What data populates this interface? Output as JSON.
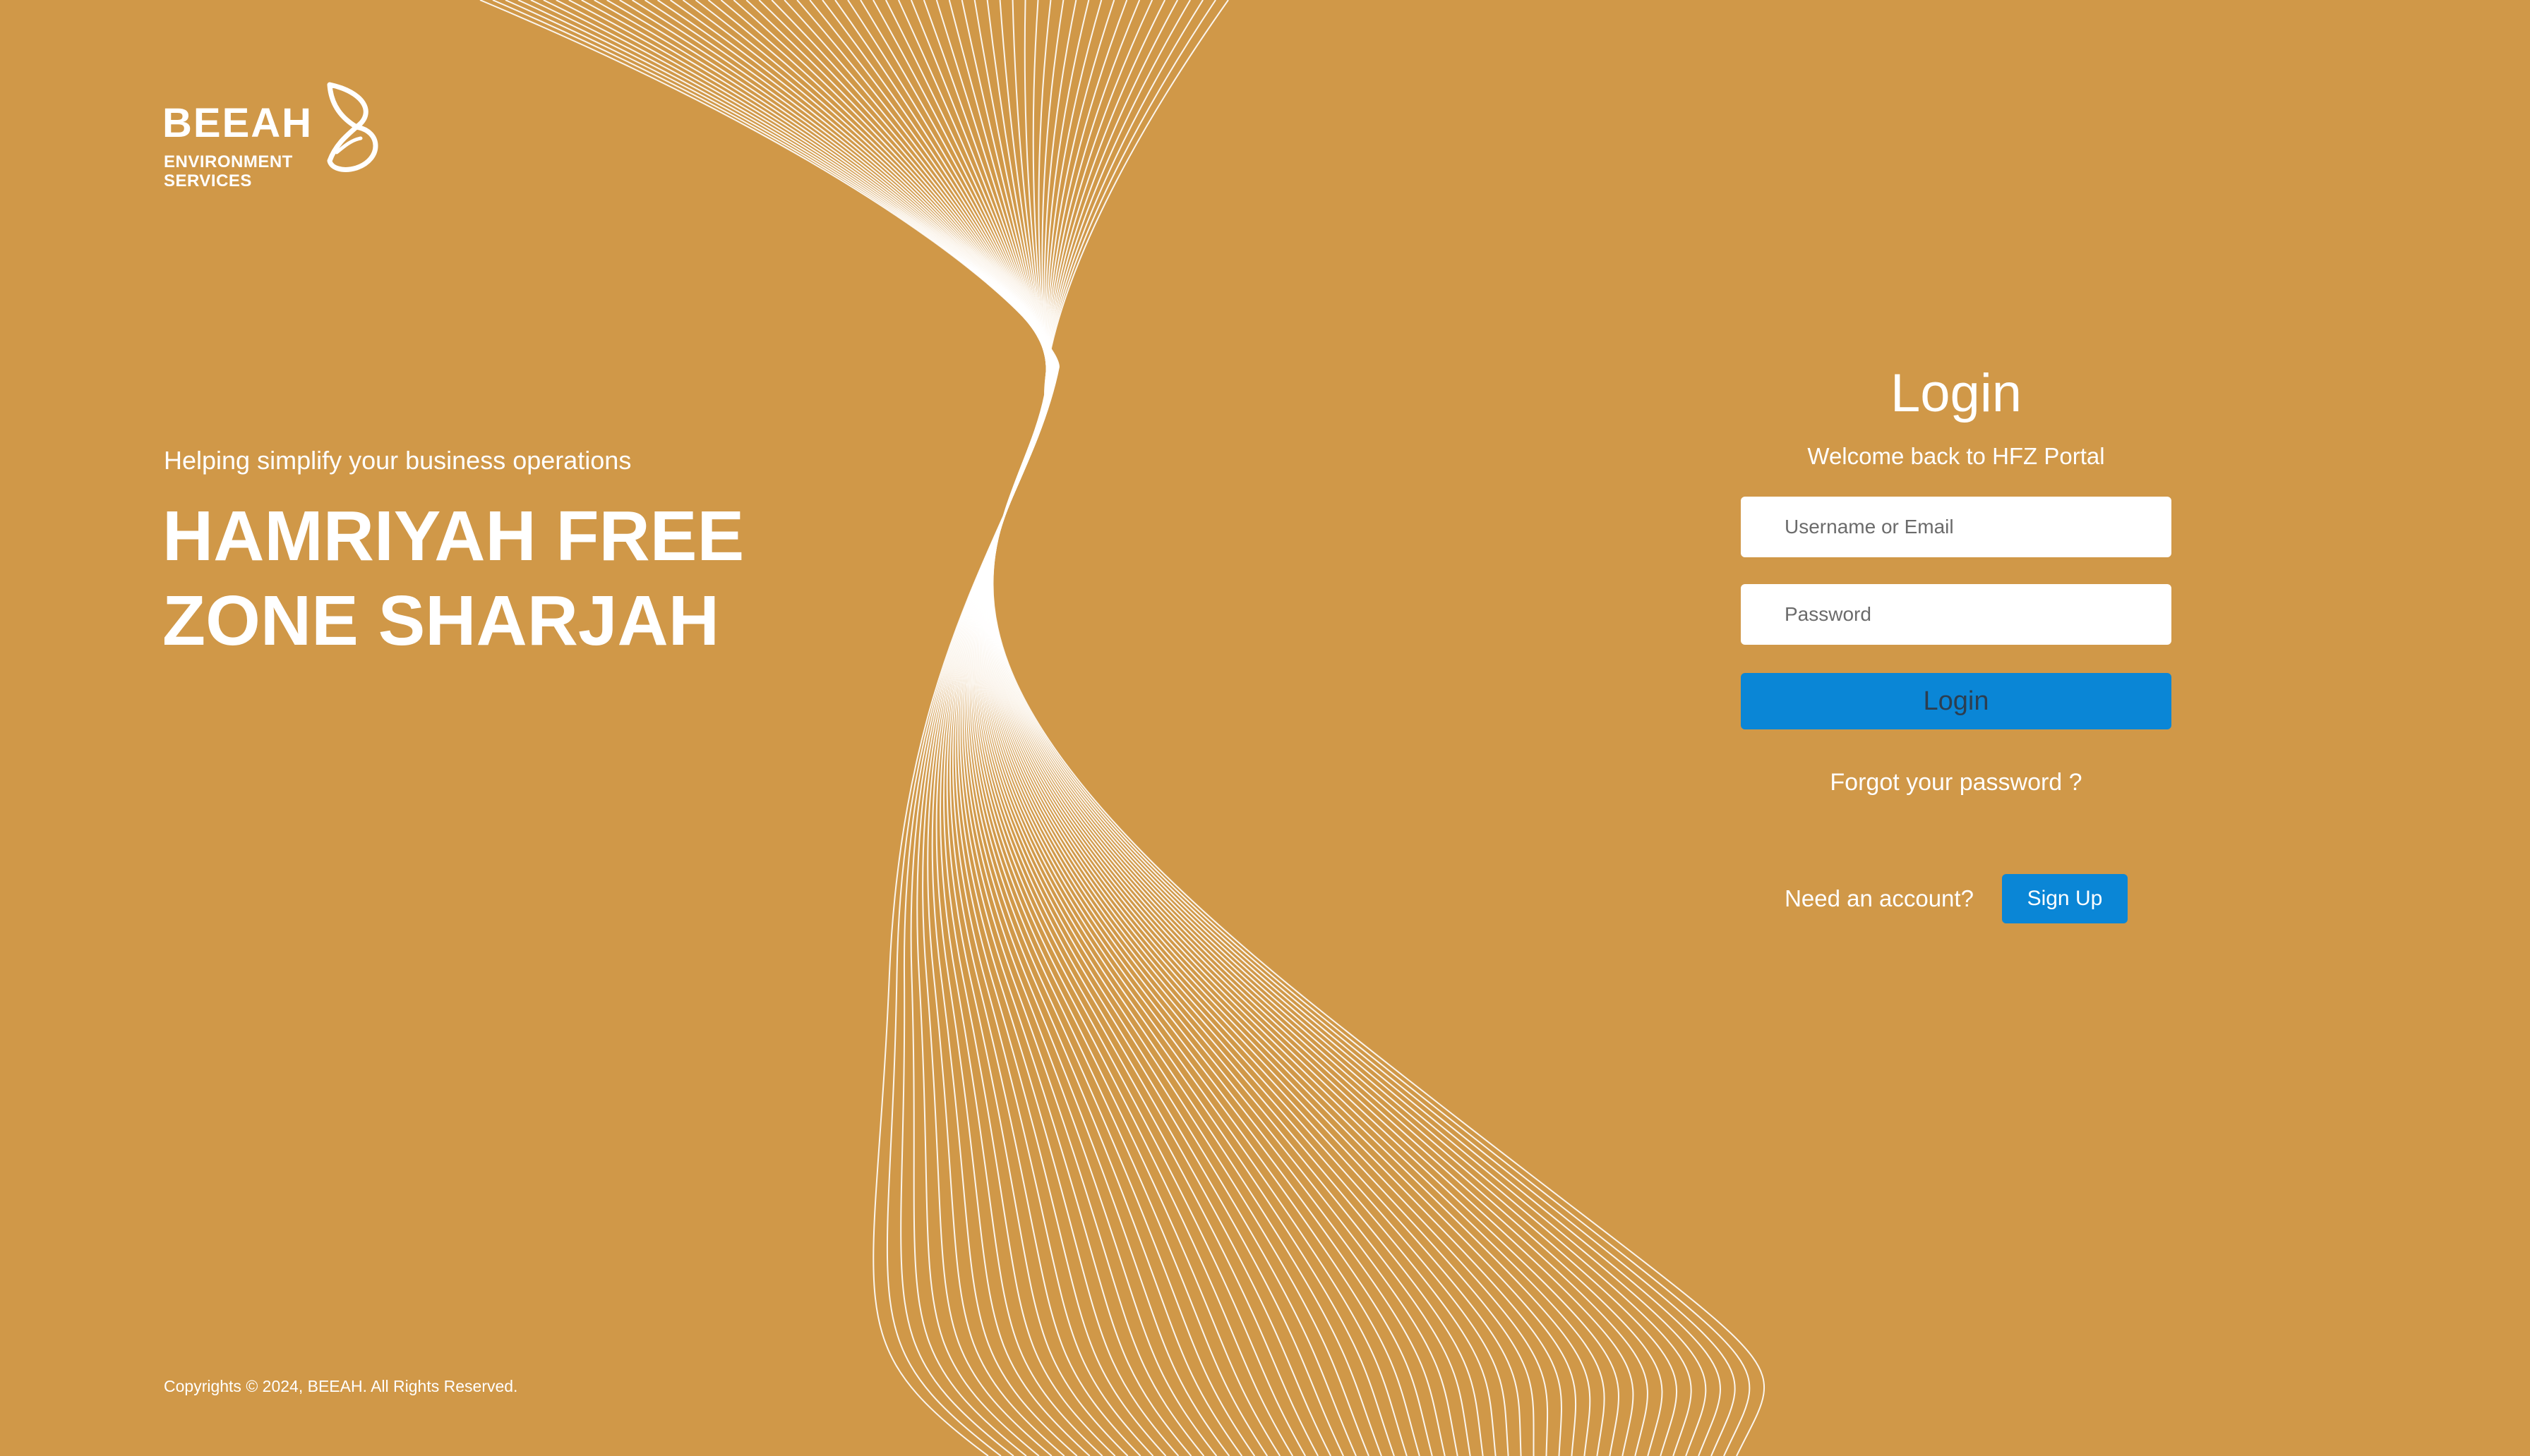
{
  "brand": {
    "name": "BEEAH",
    "sub_line_1": "ENVIRONMENT",
    "sub_line_2": "SERVICES",
    "background_color": "#D09848",
    "accent_color": "#0A86D6"
  },
  "hero": {
    "tagline": "Helping simplify your business operations",
    "headline_line_1": "HAMRIYAH FREE",
    "headline_line_2": "ZONE SHARJAH"
  },
  "login": {
    "title": "Login",
    "welcome": "Welcome back to HFZ Portal",
    "username_placeholder": "Username or Email",
    "username_value": "",
    "password_placeholder": "Password",
    "password_value": "",
    "login_button_label": "Login",
    "forgot_password_label": "Forgot your password ?",
    "need_account_label": "Need an account?",
    "signup_button_label": "Sign Up"
  },
  "footer": {
    "copyright": "Copyrights © 2024, BEEAH. All Rights Reserved."
  }
}
